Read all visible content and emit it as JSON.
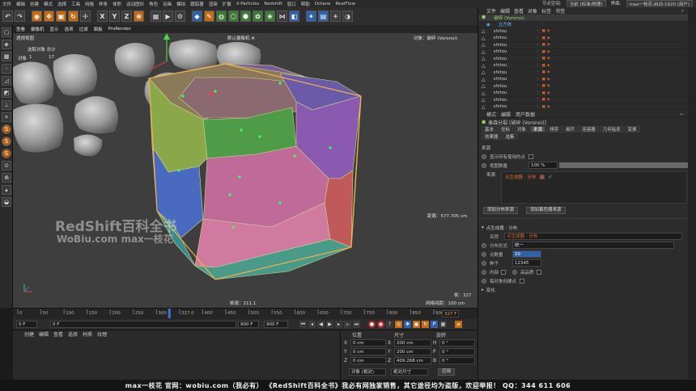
{
  "menubar": {
    "items": [
      "文件",
      "编辑",
      "创建",
      "模式",
      "选择",
      "工具",
      "网格",
      "样条",
      "体积",
      "运动图形",
      "角色",
      "动画",
      "模拟",
      "跟踪器",
      "渲染",
      "扩展",
      "X-Particles",
      "Redshift",
      "窗口",
      "帮助",
      "Octane",
      "RealFlow"
    ],
    "node_space_label": "节点空间:",
    "node_space_value": "当前 (标准/物理)",
    "layout_label": "界面:",
    "layout_value": "max一枝花-启动-1920 (用户)"
  },
  "toolbar": {
    "axes": [
      "X",
      "Y",
      "Z"
    ]
  },
  "viewport": {
    "menu": [
      "查看",
      "摄像机",
      "显示",
      "选项",
      "过滤",
      "面板",
      "ProRender"
    ],
    "view_name": "透视视图",
    "camera": "默认摄像机 ✲",
    "selected_label": "选取对象 总计",
    "objects_label": "对象",
    "objects_selected": "1",
    "objects_total": "17",
    "object_name": "对象：破碎 (Voronoi)",
    "distance": "距离：577.705 cm",
    "fps": "帧速：111.1",
    "grid": "网格间距：100 cm",
    "frames_label": "帧：327",
    "watermark1": "RedShift百科全书",
    "watermark2": "WoBiu.com  max一枝花"
  },
  "timeline": {
    "ticks": [
      "0",
      "50",
      "100",
      "150",
      "200",
      "250",
      "300",
      "327.0",
      "400",
      "450",
      "500",
      "550",
      "600",
      "650",
      "700",
      "750",
      "800",
      "850",
      "900"
    ],
    "current_frame": "327 F",
    "playhead": 327,
    "range_end": 900
  },
  "transport": {
    "start": "0 F",
    "min": "0 F",
    "max": "900 F",
    "end": "900 F"
  },
  "material": {
    "menu": [
      "创建",
      "编辑",
      "查看",
      "选择",
      "材质",
      "纹理"
    ]
  },
  "coords": {
    "headers": [
      "位置",
      "尺寸",
      "旋转"
    ],
    "rows": [
      {
        "axis": "X",
        "pos": "0 cm",
        "size": "200 cm",
        "rot_axis": "H",
        "rot": "0 °"
      },
      {
        "axis": "Y",
        "pos": "0 cm",
        "size": "200 cm",
        "rot_axis": "P",
        "rot": "0 °"
      },
      {
        "axis": "Z",
        "pos": "0 cm",
        "size": "409.268 cm",
        "rot_axis": "B",
        "rot": "0 °"
      }
    ],
    "mode1": "对象 (相对)",
    "mode2": "绝对尺寸",
    "apply": "应用"
  },
  "objects": {
    "menu": [
      "文件",
      "编辑",
      "查看",
      "对象",
      "标签",
      "书签"
    ],
    "rows": [
      {
        "name": "破碎 (Voronoi)",
        "color": "#8fd16a"
      },
      {
        "name": "立方体",
        "color": "#4aa3e0"
      },
      {
        "name": "shitou",
        "color": "#cccccc"
      },
      {
        "name": "shitou",
        "color": "#cccccc"
      },
      {
        "name": "shitou",
        "color": "#cccccc"
      },
      {
        "name": "shitou",
        "color": "#cccccc"
      },
      {
        "name": "shitou",
        "color": "#cccccc"
      },
      {
        "name": "shitou",
        "color": "#cccccc"
      },
      {
        "name": "shitou",
        "color": "#cccccc"
      },
      {
        "name": "shitou",
        "color": "#cccccc"
      },
      {
        "name": "shitou",
        "color": "#cccccc"
      },
      {
        "name": "shitou",
        "color": "#cccccc"
      },
      {
        "name": "shitou",
        "color": "#cccccc"
      },
      {
        "name": "shitou",
        "color": "#cccccc"
      }
    ]
  },
  "attributes": {
    "menu": [
      "模式",
      "编辑",
      "用户数据"
    ],
    "object_title": "泰森分裂 [破碎 (Voronoi)]",
    "tabs_row1": [
      "基本",
      "坐标",
      "对象",
      "来源",
      "排序",
      "细节",
      "连接器",
      "几何粘连",
      "变换"
    ],
    "tabs_row2": [
      "效果器",
      "选集"
    ],
    "active_tab": "来源",
    "section_source": "来源",
    "show_all_points": "显示所有使用的点",
    "viewport_amount_label": "视图数量",
    "viewport_amount": "100 %",
    "viewport_amount_frac": 1.0,
    "source_label": "来源",
    "source_item": "点生成器 - 分布",
    "add_dist_source": "添加分布来源",
    "add_shader_source": "添加着色器来源",
    "generator_section": "点生成器 - 分布",
    "name_label": "名称",
    "name_value": "点生成器 - 分布",
    "dist_type_label": "分布形式",
    "dist_type_value": "统一",
    "count_label": "点数量",
    "count_value": "10",
    "seed_label": "种子",
    "seed_value": "12345",
    "inner_label": "内部",
    "hq_label": "高品质",
    "per_object_label": "每对象创建点",
    "transform_label": "变化"
  },
  "footer": {
    "text": "max一枝花 官网：wobiu.com（我必有）  《RedShift百科全书》我必有网独家销售，其它途径均为盗版，欢迎举报！  QQ：344 611 606"
  }
}
